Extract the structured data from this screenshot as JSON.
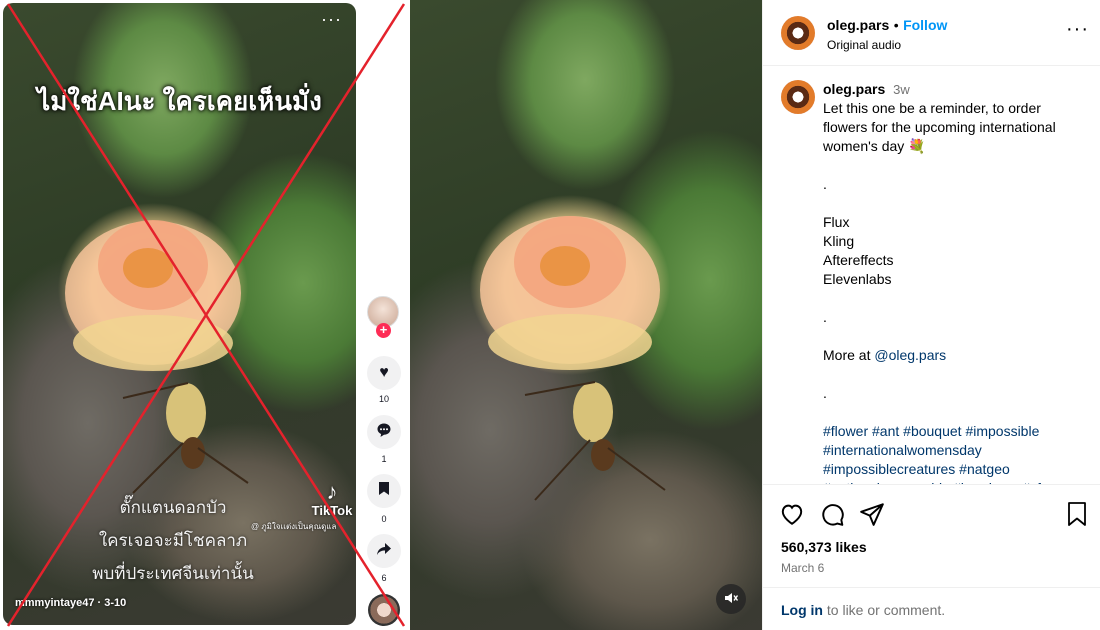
{
  "tiktok": {
    "menu_glyph": "···",
    "headline": "ไม่ใช่AIนะ ใครเคยเห็นมั่ง",
    "caption_lines": [
      "ตั๊กแตนดอกบัว",
      "ใครเจอจะมีโชคลาภ",
      "พบที่ประเทศจีนเท่านั้น"
    ],
    "logo_text": "TikTok",
    "handle_overlay": "@ ภูมิใจเเต่งเป็นคุณดูแล",
    "username": "mmmyintaye47 · 3-10",
    "rail": {
      "likes": "10",
      "comments": "1",
      "bookmarks": "0",
      "shares": "6"
    },
    "cross_color": "#e4222c"
  },
  "instagram": {
    "username": "oleg.pars",
    "separator": "•",
    "follow_label": "Follow",
    "audio": "Original audio",
    "more_glyph": "···",
    "post_time": "3w",
    "caption": {
      "line1": "Let this one be a reminder, to order flowers for the upcoming international women's day 💐",
      "dot1": ".",
      "tools": [
        "Flux",
        "Kling",
        "Aftereffects",
        "Elevenlabs"
      ],
      "dot2": ".",
      "more_prefix": "More at ",
      "more_link": "@oleg.pars",
      "dot3": ".",
      "hashtags": "#flower #ant #bouquet #impossible #internationalwomensday #impossiblecreatures #natgeo #nationalgeographic #handcam #vfx"
    },
    "likes": "560,373 likes",
    "date": "March 6",
    "login_link": "Log in",
    "login_rest": " to like or comment.",
    "accent": "#0095f6"
  }
}
